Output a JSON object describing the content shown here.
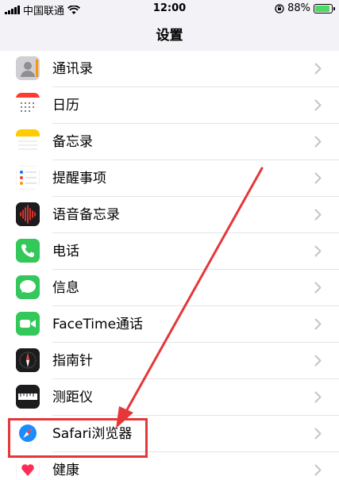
{
  "status_bar": {
    "carrier": "中国联通",
    "time": "12:00",
    "battery": "88%",
    "battery_level": 0.88
  },
  "nav": {
    "title": "设置"
  },
  "settings": [
    {
      "label": "通讯录",
      "icon": "contacts-icon",
      "color": "#b9b9bd"
    },
    {
      "label": "日历",
      "icon": "calendar-icon",
      "color": "#ffffff"
    },
    {
      "label": "备忘录",
      "icon": "notes-icon",
      "color": "#ffffff"
    },
    {
      "label": "提醒事项",
      "icon": "reminders-icon",
      "color": "#ffffff"
    },
    {
      "label": "语音备忘录",
      "icon": "voice-memos-icon",
      "color": "#1c1c1e"
    },
    {
      "label": "电话",
      "icon": "phone-icon",
      "color": "#34c759"
    },
    {
      "label": "信息",
      "icon": "messages-icon",
      "color": "#34c759"
    },
    {
      "label": "FaceTime通话",
      "icon": "facetime-icon",
      "color": "#34c759"
    },
    {
      "label": "指南针",
      "icon": "compass-icon",
      "color": "#1c1c1e"
    },
    {
      "label": "测距仪",
      "icon": "measure-icon",
      "color": "#1c1c1e"
    },
    {
      "label": "Safari浏览器",
      "icon": "safari-icon",
      "color": "#ffffff"
    },
    {
      "label": "健康",
      "icon": "health-icon",
      "color": "#ffffff"
    }
  ],
  "annotation_color": "#e5373a"
}
